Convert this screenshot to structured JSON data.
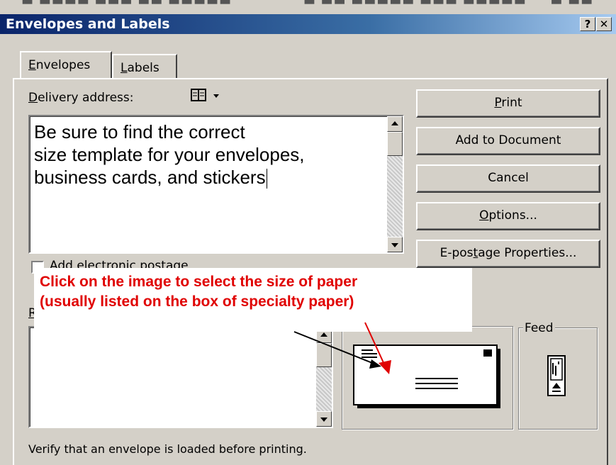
{
  "window": {
    "title": "Envelopes and Labels",
    "help_glyph": "?",
    "close_glyph": "✕"
  },
  "tabs": [
    {
      "label": "Envelopes",
      "hotkey": "E",
      "rest": "nvelopes",
      "active": true
    },
    {
      "label": "Labels",
      "hotkey": "L",
      "rest": "abels",
      "active": false
    }
  ],
  "delivery": {
    "label_hotkey": "D",
    "label_rest": "elivery address:",
    "address_lines": [
      "Be sure to find the correct",
      "size template for your envelopes,",
      "business cards, and stickers"
    ]
  },
  "add_epostage": {
    "label": "Add electronic postage"
  },
  "return": {
    "label_hotkey": "R"
  },
  "buttons": {
    "print_hotkey": "P",
    "print_rest": "rint",
    "add_to_document": "Add to Document",
    "cancel": "Cancel",
    "options_hotkey": "O",
    "options_rest": "ptions...",
    "epostage_pre": "E-pos",
    "epostage_hotkey": "t",
    "epostage_rest": "age Properties..."
  },
  "callout": {
    "line1": "Click on the image to select the size of paper",
    "line2": "(usually listed on the box of specialty paper)",
    "color": "#e00000"
  },
  "feed": {
    "title": "Feed"
  },
  "footer": {
    "text": "Verify that an envelope is loaded before printing."
  }
}
